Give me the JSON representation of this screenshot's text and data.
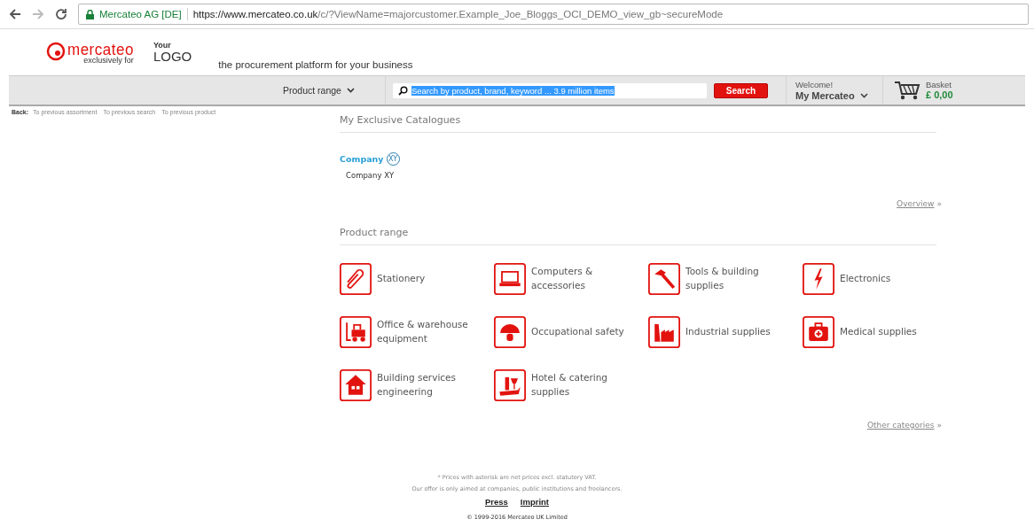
{
  "browser": {
    "site_identity": "Mercateo AG [DE]",
    "url_host": "https://www.mercateo.co.uk",
    "url_path": "/c/?ViewName=majorcustomer.Example_Joe_Bloggs_OCI_DEMO_view_gb~secureMode"
  },
  "header": {
    "brand": "mercateo",
    "brand_sub": "exclusively for",
    "logo_top": "Your",
    "logo_bottom": "LOGO",
    "tagline": "the procurement platform for your business"
  },
  "nav": {
    "product_range": "Product range",
    "search": {
      "value": "Search by product, brand, keyword ... 3.9 million items",
      "selected": true
    },
    "search_button": "Search",
    "welcome": "Welcome!",
    "account": "My Mercateo",
    "basket_label": "Basket",
    "basket_total": "£ 0,00"
  },
  "back_links": {
    "label": "Back:",
    "links": [
      "To previous assortment",
      "To previous search",
      "To previous product"
    ]
  },
  "catalogues": {
    "title": "My Exclusive Catalogues",
    "items": [
      {
        "logo_word": "Company",
        "logo_badge": "XY",
        "name": "Company XY"
      }
    ],
    "more": "Overview",
    "more_mark": "»"
  },
  "product_range": {
    "title": "Product range",
    "categories": [
      {
        "kind": "clip",
        "label": "Stationery"
      },
      {
        "kind": "laptop",
        "label": "Computers & accessories"
      },
      {
        "kind": "hammer",
        "label": "Tools & building supplies"
      },
      {
        "kind": "bolt",
        "label": "Electronics"
      },
      {
        "kind": "forklift",
        "label": "Office & warehouse equipment"
      },
      {
        "kind": "helmet",
        "label": "Occupational safety"
      },
      {
        "kind": "factory",
        "label": "Industrial supplies"
      },
      {
        "kind": "medkit",
        "label": "Medical supplies"
      },
      {
        "kind": "house",
        "label": "Building services engineering"
      },
      {
        "kind": "tray",
        "label": "Hotel & catering supplies"
      }
    ],
    "more": "Other categories",
    "more_mark": "»"
  },
  "footer": {
    "notes": [
      "* Prices with asterisk are net prices excl. statutory VAT.",
      "Our offer is only aimed at companies, public institutions and freelancers."
    ],
    "links": [
      "Press",
      "Imprint"
    ],
    "copyright": "© 1999-2016 Mercateo UK Limited"
  }
}
